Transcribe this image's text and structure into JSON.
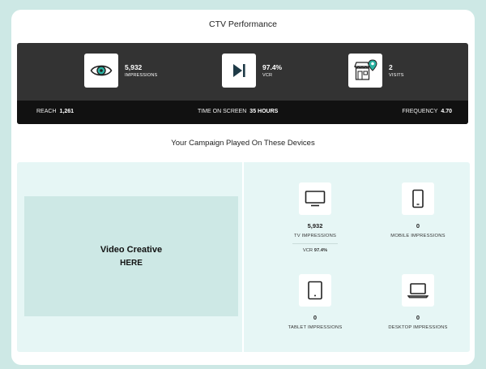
{
  "header": {
    "title": "CTV Performance"
  },
  "summary": {
    "stats": [
      {
        "icon": "eye-icon",
        "value": "5,932",
        "label": "IMPRESSIONS"
      },
      {
        "icon": "play-skip-icon",
        "value": "97.4%",
        "label": "VCR"
      },
      {
        "icon": "storefront-pin-icon",
        "value": "2",
        "label": "VISITS"
      }
    ],
    "metrics": {
      "reach_label": "REACH",
      "reach_value": "1,261",
      "time_label": "TIME ON SCREEN",
      "time_value": "35 HOURS",
      "frequency_label": "FREQUENCY",
      "frequency_value": "4.70"
    }
  },
  "devices": {
    "subtitle": "Your Campaign Played On These Devices",
    "video": {
      "line1": "Video Creative",
      "line2": "HERE"
    },
    "tv": {
      "value": "5,932",
      "label": "TV IMPRESSIONS",
      "vcr_label": "VCR",
      "vcr_value": "97.4%"
    },
    "mobile": {
      "value": "0",
      "label": "MOBILE IMPRESSIONS"
    },
    "tablet": {
      "value": "0",
      "label": "TABLET IMPRESSIONS"
    },
    "desktop": {
      "value": "0",
      "label": "DESKTOP IMPRESSIONS"
    }
  },
  "colors": {
    "background": "#cde8e5",
    "panel_dark": "#333333",
    "panel_darker": "#111111",
    "accent_teal": "#2bb3a3",
    "devices_bg": "#e6f6f5"
  }
}
